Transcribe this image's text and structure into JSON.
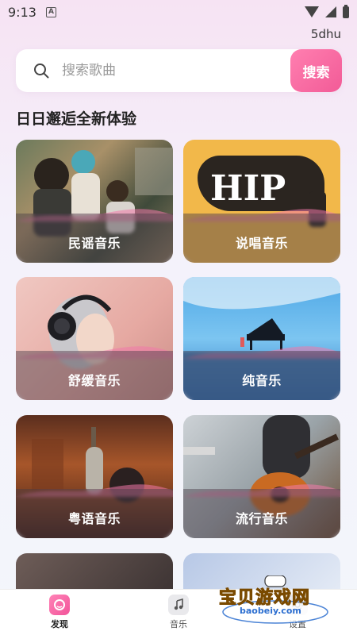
{
  "status_bar": {
    "time": "9:13",
    "notification_letter": "A"
  },
  "username": "5dhu",
  "search": {
    "placeholder": "搜索歌曲",
    "button_label": "搜索"
  },
  "section_title": "日日邂逅全新体验",
  "categories": [
    {
      "label": "民谣音乐"
    },
    {
      "label": "说唱音乐",
      "image_text": "HIP"
    },
    {
      "label": "舒缓音乐"
    },
    {
      "label": "纯音乐"
    },
    {
      "label": "粤语音乐"
    },
    {
      "label": "流行音乐"
    }
  ],
  "bottom_nav": [
    {
      "label": "发现",
      "icon": "discover-icon",
      "active": true
    },
    {
      "label": "音乐",
      "icon": "music-note-icon",
      "active": false
    },
    {
      "label": "设置",
      "icon": "settings-icon",
      "active": false
    }
  ],
  "watermark": {
    "title": "宝贝游戏网",
    "url": "baobeiy.com"
  },
  "colors": {
    "accent": "#f25b97",
    "background": "#f4f1fb"
  }
}
